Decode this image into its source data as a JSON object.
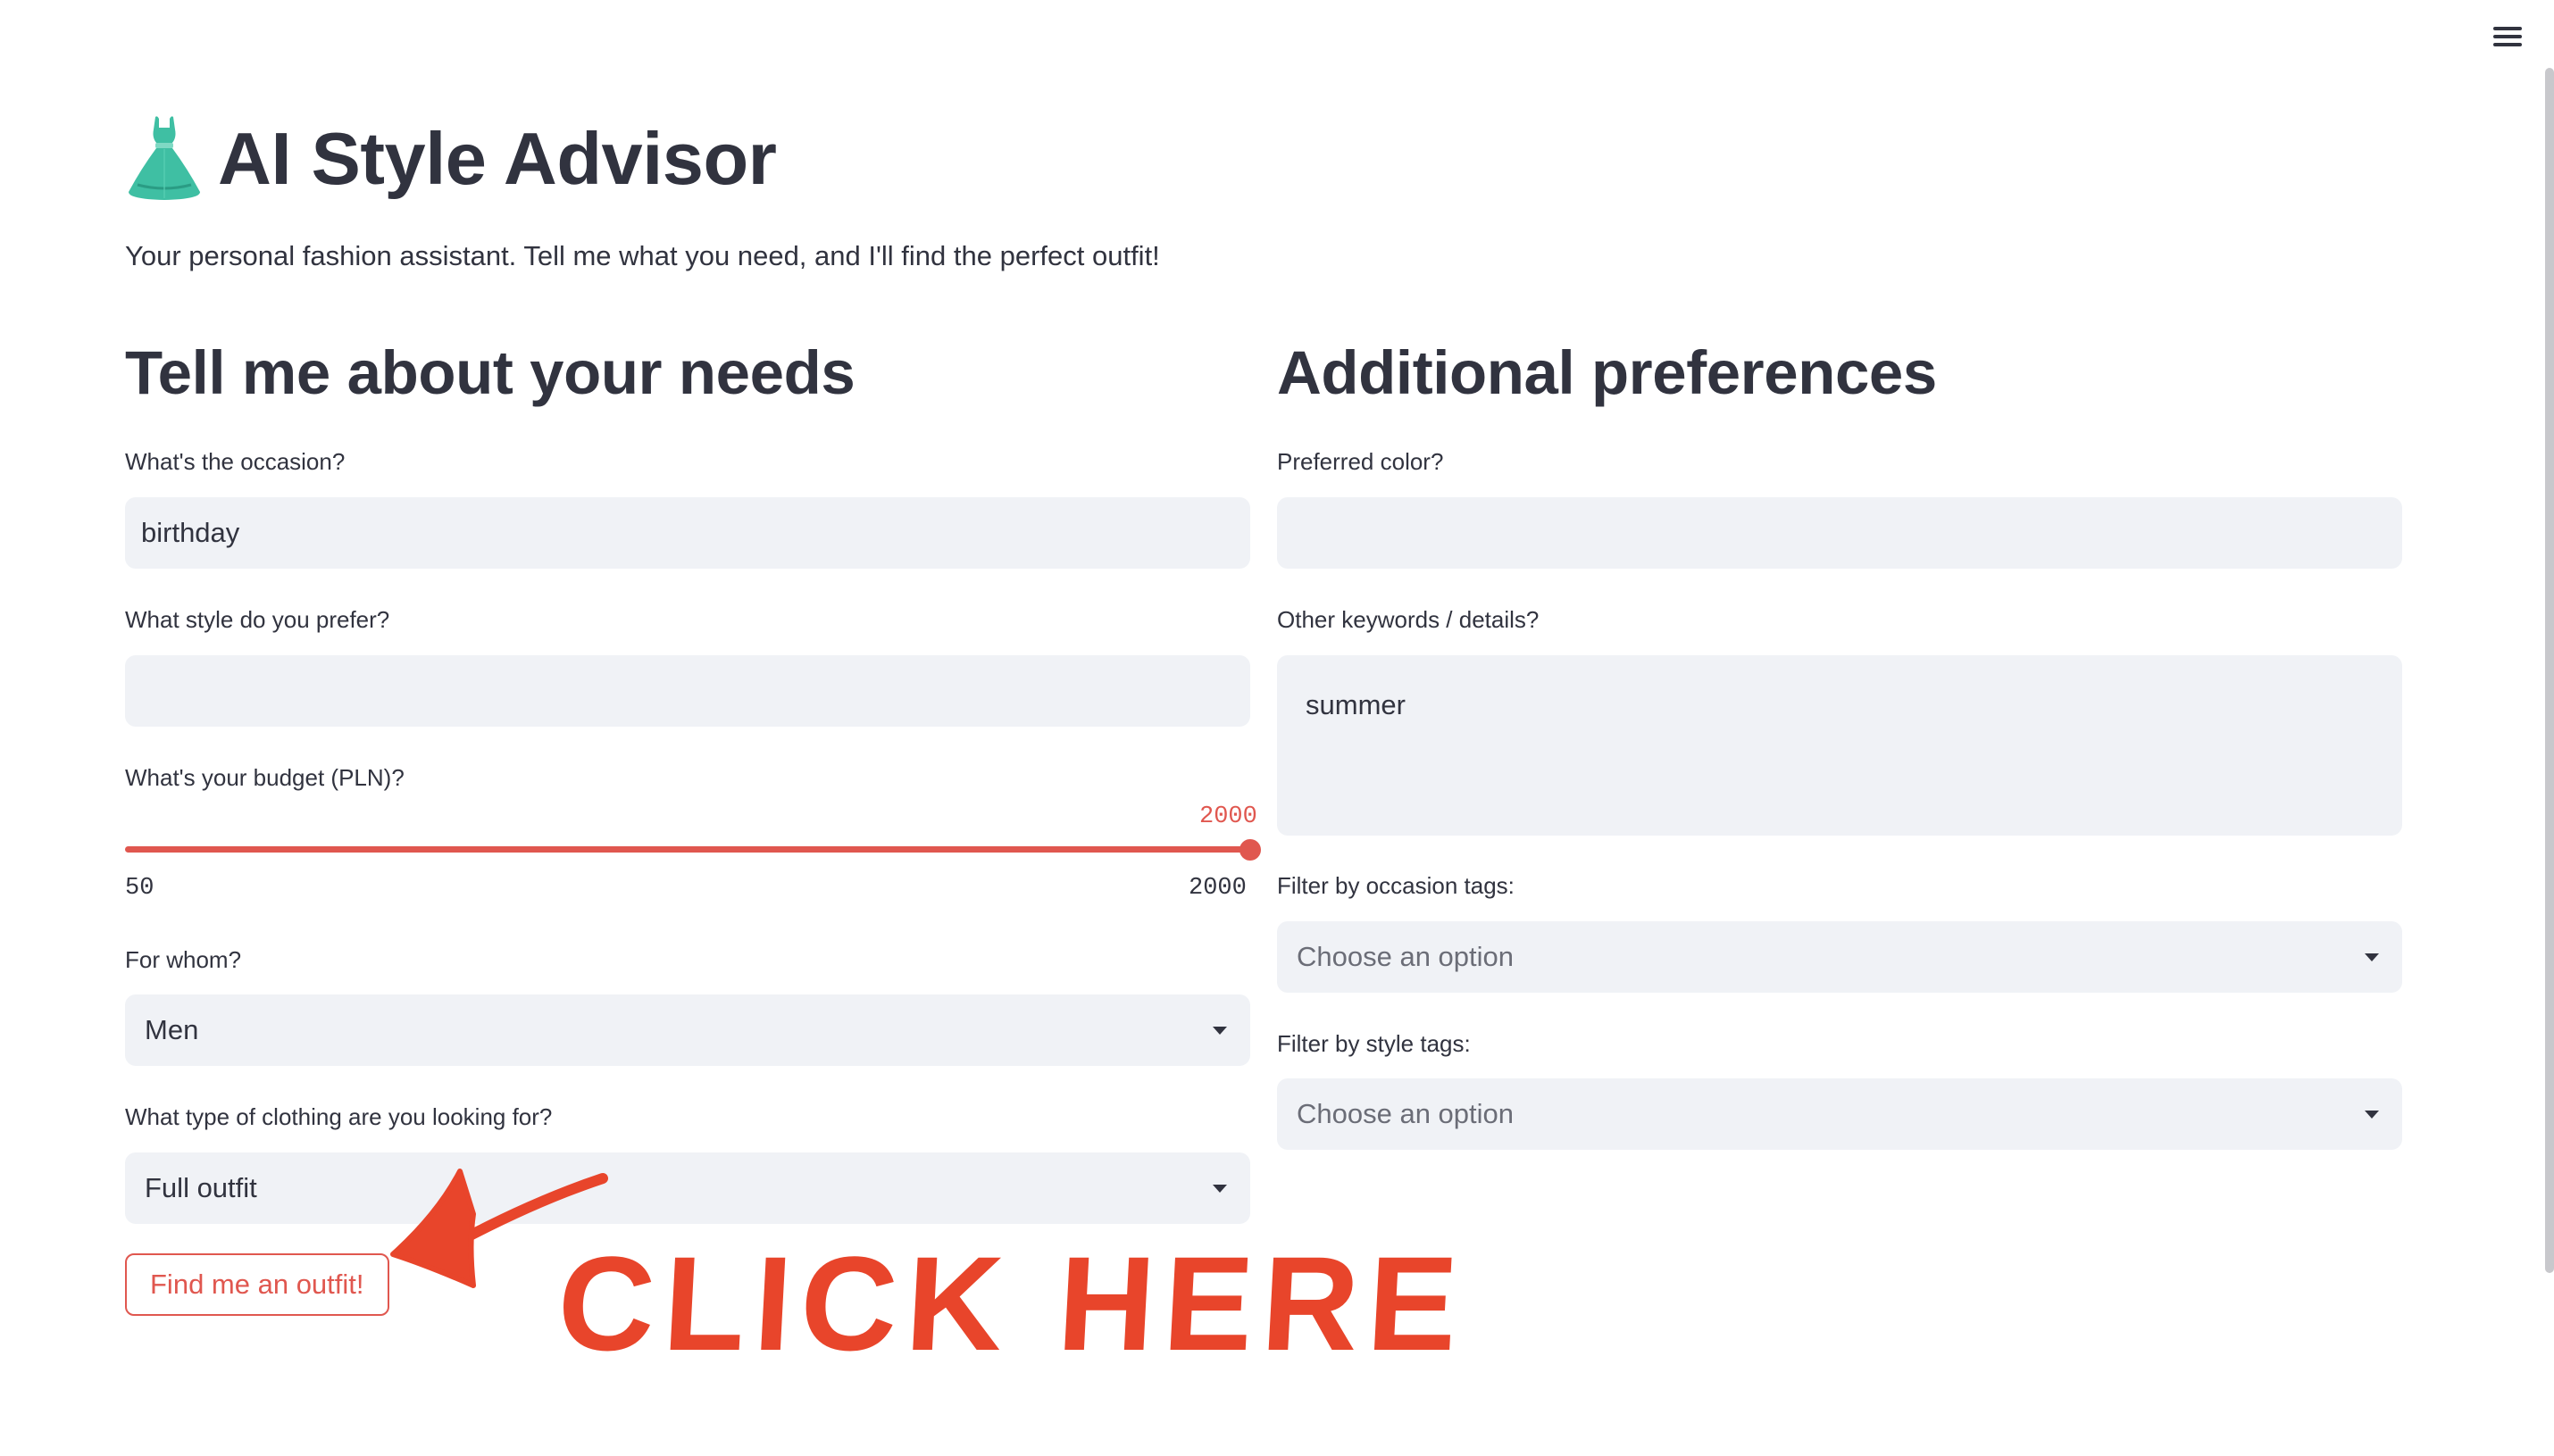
{
  "app": {
    "title_icon": "dress-icon",
    "title": "AI Style Advisor",
    "subtitle": "Your personal fashion assistant. Tell me what you need, and I'll find the perfect outfit!",
    "menu_icon": "hamburger-menu-icon"
  },
  "left_column": {
    "heading": "Tell me about your needs",
    "occasion": {
      "label": "What's the occasion?",
      "value": "birthday"
    },
    "style": {
      "label": "What style do you prefer?",
      "value": ""
    },
    "budget": {
      "label": "What's your budget (PLN)?",
      "value": "2000",
      "min": "50",
      "max": "2000",
      "accent_color": "#e0574f"
    },
    "for_whom": {
      "label": "For whom?",
      "value": "Men"
    },
    "clothing_type": {
      "label": "What type of clothing are you looking for?",
      "value": "Full outfit"
    },
    "submit_label": "Find me an outfit!"
  },
  "right_column": {
    "heading": "Additional preferences",
    "color": {
      "label": "Preferred color?",
      "value": ""
    },
    "keywords": {
      "label": "Other keywords / details?",
      "value": "summer"
    },
    "occasion_tags": {
      "label": "Filter by occasion tags:",
      "placeholder": "Choose an option"
    },
    "style_tags": {
      "label": "Filter by style tags:",
      "placeholder": "Choose an option"
    }
  },
  "annotation": {
    "text": "CLICK HERE",
    "color": "#e8452b",
    "arrow_icon": "hand-drawn-arrow-icon"
  }
}
